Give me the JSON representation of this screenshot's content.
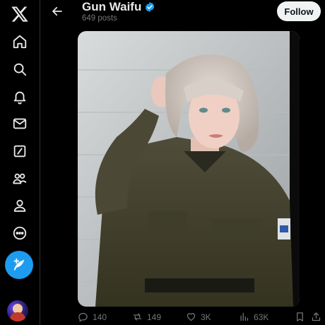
{
  "nav": {
    "items": [
      {
        "name": "x-logo-icon"
      },
      {
        "name": "home-icon"
      },
      {
        "name": "explore-icon"
      },
      {
        "name": "notifications-icon"
      },
      {
        "name": "messages-icon"
      },
      {
        "name": "grok-icon"
      },
      {
        "name": "communities-icon"
      },
      {
        "name": "profile-icon"
      },
      {
        "name": "more-icon"
      }
    ],
    "post_button_icon": "compose-icon",
    "accent": "#1d9bf0"
  },
  "header": {
    "title": "Gun Waifu",
    "subtitle": "649 posts",
    "follow_label": "Follow",
    "verified_color": "#1d9bf0"
  },
  "media": {
    "subject": "photo"
  },
  "actions": {
    "replies": "140",
    "reposts": "149",
    "likes": "3K",
    "views": "63K"
  }
}
